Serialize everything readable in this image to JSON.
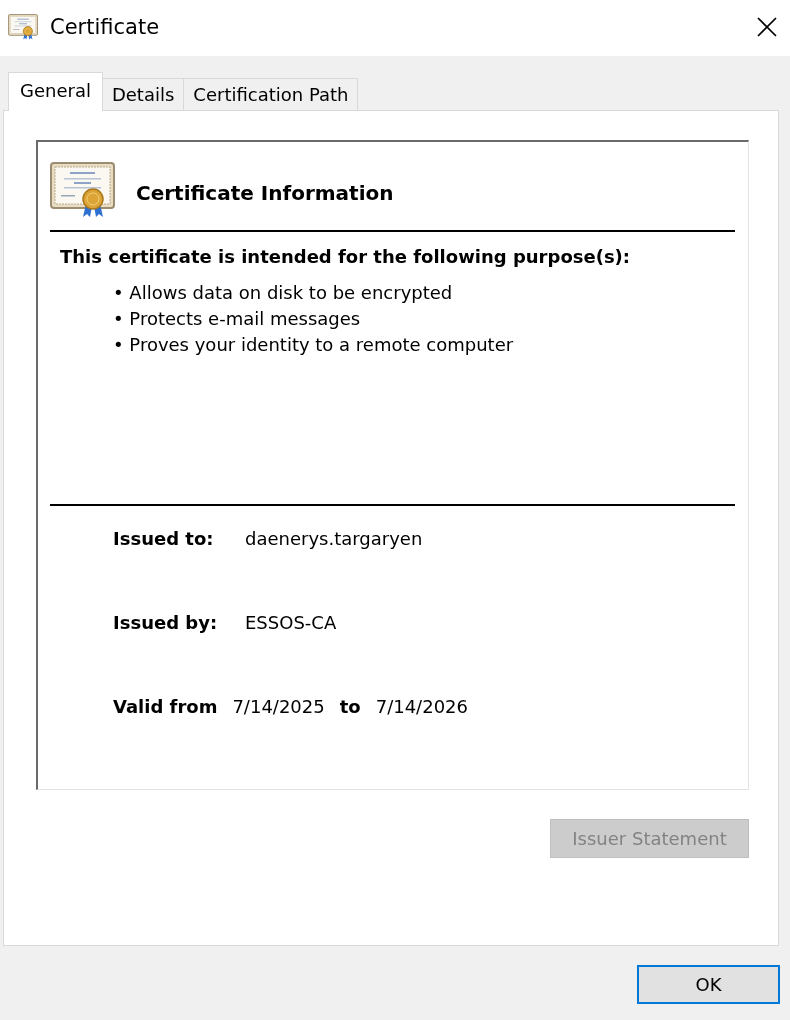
{
  "window": {
    "title": "Certificate"
  },
  "tabs": [
    {
      "label": "General",
      "selected": true
    },
    {
      "label": "Details",
      "selected": false
    },
    {
      "label": "Certification Path",
      "selected": false
    }
  ],
  "certificate_information": {
    "title": "Certificate Information",
    "purpose_heading": "This certificate is intended for the following purpose(s):",
    "purposes": [
      "• Allows data on disk to be encrypted",
      "• Protects e-mail messages",
      "• Proves your identity to a remote computer"
    ],
    "fields": [
      {
        "label": "Issued to:",
        "value": "daenerys.targaryen"
      },
      {
        "label": "Issued by:",
        "value": "ESSOS-CA"
      }
    ],
    "validity": {
      "label": "Valid from",
      "from": "7/14/2025",
      "to_label": "to",
      "to": "7/14/2026"
    }
  },
  "issuer_statement_button": {
    "label": "Issuer Statement",
    "disabled": true,
    "default": false
  },
  "buttons": [
    {
      "label": "OK",
      "disabled": false,
      "default": true
    }
  ]
}
